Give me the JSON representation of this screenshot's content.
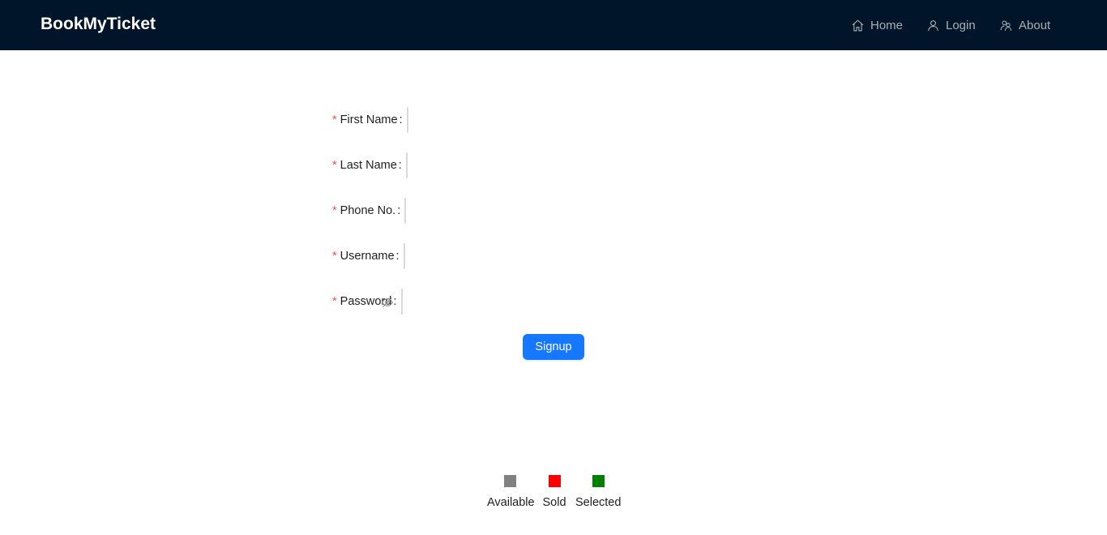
{
  "header": {
    "brand": "BookMyTicket",
    "nav": [
      {
        "label": "Home",
        "icon": "home-icon"
      },
      {
        "label": "Login",
        "icon": "user-icon"
      },
      {
        "label": "About",
        "icon": "team-icon"
      }
    ]
  },
  "form": {
    "fields": [
      {
        "label": "First Name",
        "value": ""
      },
      {
        "label": "Last Name",
        "value": ""
      },
      {
        "label": "Phone No.",
        "value": ""
      },
      {
        "label": "Username",
        "value": ""
      },
      {
        "label": "Password",
        "value": "",
        "icon": "eye-invisible-icon"
      }
    ],
    "required_mark": "*",
    "colon": ":",
    "submit_label": "Signup"
  },
  "legend": [
    {
      "label": "Available",
      "color": "#808080"
    },
    {
      "label": "Sold",
      "color": "#ff0000"
    },
    {
      "label": "Selected",
      "color": "#008000"
    }
  ],
  "colors": {
    "header_bg": "#001529",
    "primary": "#1677ff",
    "required": "#ff4d4f"
  }
}
